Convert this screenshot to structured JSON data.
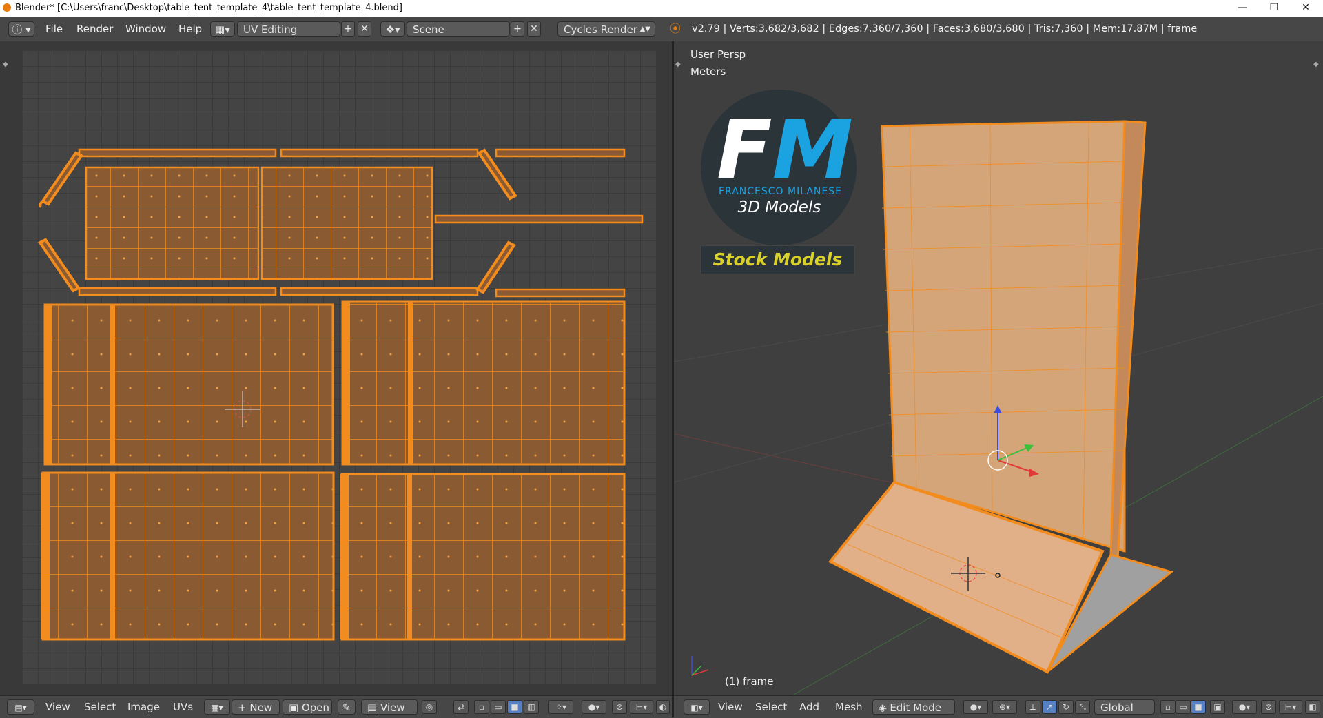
{
  "window": {
    "title": "Blender* [C:\\Users\\franc\\Desktop\\table_tent_template_4\\table_tent_template_4.blend]",
    "controls": [
      "—",
      "❐",
      "✕"
    ]
  },
  "infobar": {
    "menus": [
      "File",
      "Render",
      "Window",
      "Help"
    ],
    "layout": "UV Editing",
    "scene": "Scene",
    "engine": "Cycles Render",
    "stats": "v2.79 | Verts:3,682/3,682 | Edges:7,360/7,360 | Faces:3,680/3,680 | Tris:7,360 | Mem:17.87M | frame"
  },
  "viewport": {
    "view_name": "User Persp",
    "units": "Meters",
    "object_label": "(1) frame",
    "logo": {
      "letter_f": "F",
      "letter_m": "M",
      "subtitle": "FRANCESCO MILANESE",
      "tagline": "3D Models",
      "banner": "Stock Models"
    }
  },
  "uv_footer": {
    "menus": [
      "View",
      "Select",
      "Image",
      "UVs"
    ],
    "new_label": "New",
    "open_label": "Open",
    "view_label": "View"
  },
  "vp_footer": {
    "menus": [
      "View",
      "Select",
      "Add",
      "Mesh"
    ],
    "mode": "Edit Mode",
    "orientation": "Global"
  },
  "colors": {
    "selection": "#f28c1e",
    "face_fill": "#8a5a32",
    "accent_blue": "#1aa3e0",
    "banner_yellow": "#d9d12a"
  }
}
